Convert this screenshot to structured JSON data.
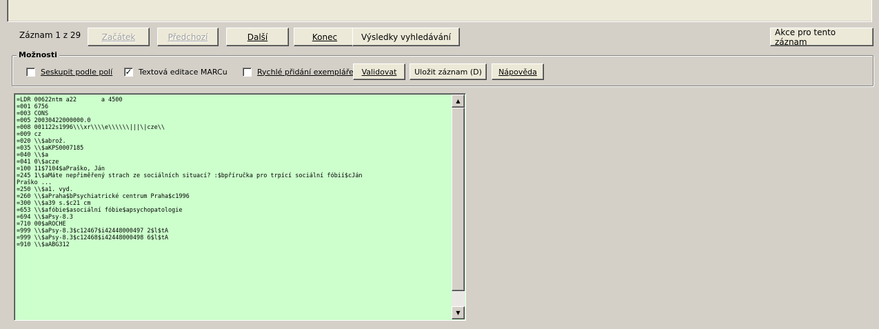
{
  "nav": {
    "record_counter": "Záznam 1 z 29",
    "first": "Začátek",
    "previous": "Předchozí",
    "next": "Další",
    "last": "Konec",
    "search_results": "Výsledky vyhledávání",
    "record_actions": "Akce pro tento záznam"
  },
  "options": {
    "legend": "Možnosti",
    "group_by_fields": {
      "label": "Seskupit podle polí",
      "checked": false
    },
    "text_marc": {
      "label": "Textová editace MARCu",
      "checked": true
    },
    "quick_add": {
      "label": "Rychlé přidání exempláře",
      "checked": false
    },
    "validate": "Validovat",
    "save_record": "Uložit záznam (D)",
    "help": "Nápověda"
  },
  "editor": {
    "lines": [
      "=LDR 00622ntm a22       a 4500",
      "=001 6756",
      "=003 CONS",
      "=005 20030422000000.0",
      "=008 001122s1996\\\\\\xr\\\\\\\\e\\\\\\\\\\\\|||\\|cze\\\\",
      "=009 cz",
      "=020 \\\\$abrož.",
      "=035 \\\\$aKPS0007185",
      "=040 \\\\$a",
      "=041 0\\$acze",
      "=100 11$7104$aPraško, Ján",
      "=245 1\\$aMáte nepřiměřený strach ze sociálních situací? :$bpříručka pro trpící sociální fóbií$cJán",
      "Praško ...",
      "=250 \\\\$a1. vyd.",
      "=260 \\\\$aPraha$bPsychiatrické centrum Praha$c1996",
      "=300 \\\\$a39 s.$c21 cm",
      "=653 \\\\$afóbie$asociální fóbie$apsychopatologie",
      "=694 \\\\$aPsy-8.3",
      "=710 00$aROCHE",
      "=999 \\\\$aPsy-8.3$c12467$i42448000497 2$l$tA",
      "=999 \\\\$aPsy-8.3$c12468$i42448000498 6$l$tA",
      "=910 \\\\$aABG312"
    ]
  }
}
